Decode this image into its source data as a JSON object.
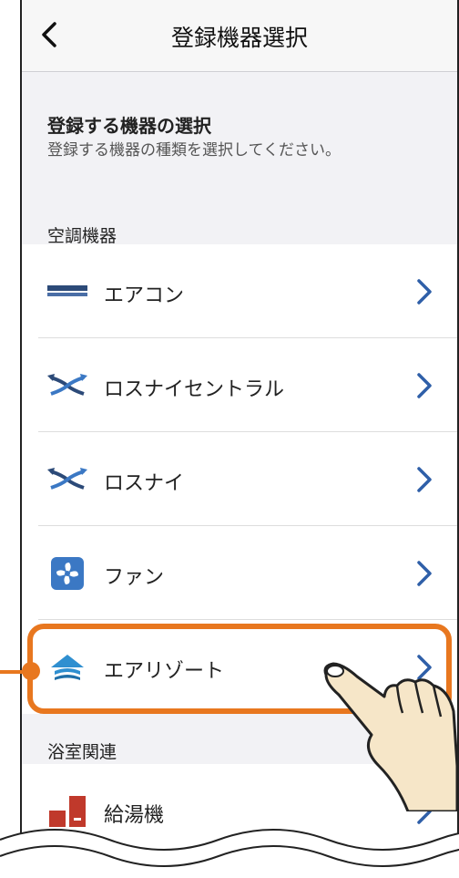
{
  "header": {
    "title": "登録機器選択",
    "back_icon": "chevron-left-icon"
  },
  "intro": {
    "title": "登録する機器の選択",
    "subtitle": "登録する機器の種類を選択してください。"
  },
  "sections": [
    {
      "label": "空調機器",
      "items": [
        {
          "label": "エアコン",
          "icon": "aircon-icon"
        },
        {
          "label": "ロスナイセントラル",
          "icon": "lossnay-central-icon"
        },
        {
          "label": "ロスナイ",
          "icon": "lossnay-icon"
        },
        {
          "label": "ファン",
          "icon": "fan-icon"
        },
        {
          "label": "エアリゾート",
          "icon": "air-resort-icon"
        }
      ]
    },
    {
      "label": "浴室関連",
      "items": [
        {
          "label": "給湯機",
          "icon": "water-heater-icon"
        }
      ]
    }
  ],
  "colors": {
    "accent": "#e8771f",
    "chevron": "#2f5fa8",
    "aircon": "#2c4a78",
    "fan_bg": "#3b78c4",
    "heater": "#c0392b"
  }
}
